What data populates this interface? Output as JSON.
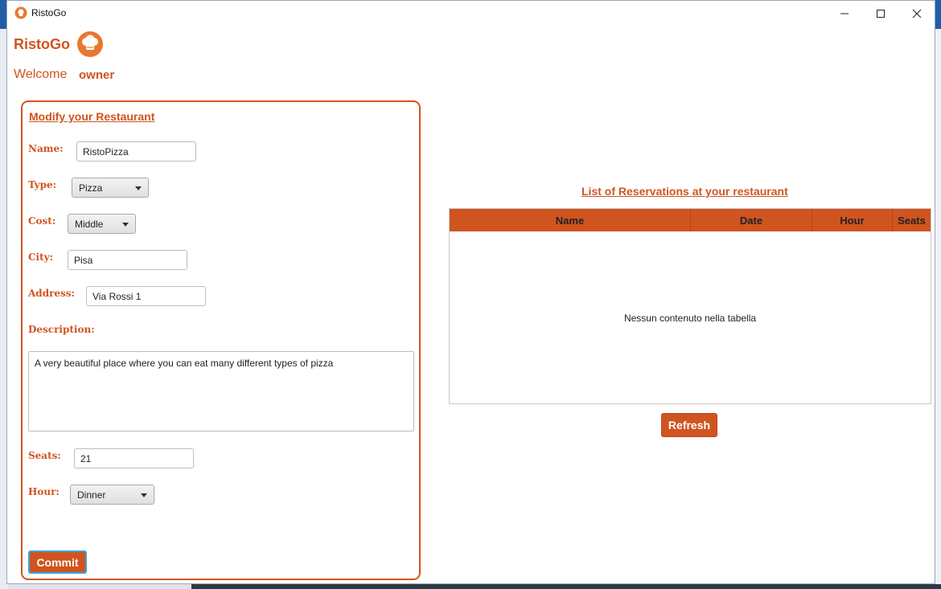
{
  "window": {
    "title": "RistoGo"
  },
  "header": {
    "brand": "RistoGo",
    "welcome_label": "Welcome",
    "username": "owner"
  },
  "form": {
    "title": "Modify your Restaurant",
    "name_label": "Name:",
    "name_value": "RistoPizza",
    "type_label": "Type:",
    "type_value": "Pizza",
    "cost_label": "Cost:",
    "cost_value": "Middle",
    "city_label": "City:",
    "city_value": "Pisa",
    "address_label": "Address:",
    "address_value": "Via Rossi 1",
    "description_label": "Description:",
    "description_value": "A very beautiful place where you can eat many different types of pizza",
    "seats_label": "Seats:",
    "seats_value": "21",
    "hour_label": "Hour:",
    "hour_value": "Dinner",
    "commit_label": "Commit"
  },
  "reservations": {
    "title": "List of Reservations at your restaurant",
    "columns": [
      "Name",
      "Date",
      "Hour",
      "Seats"
    ],
    "empty_text": "Nessun contenuto nella tabella",
    "refresh_label": "Refresh"
  },
  "colors": {
    "accent": "#d0541f",
    "focus_border": "#39a7e0"
  },
  "icons": {
    "app_icon": "chef-hat-icon",
    "minimize": "minimize-icon",
    "maximize": "maximize-icon",
    "close": "close-icon"
  }
}
